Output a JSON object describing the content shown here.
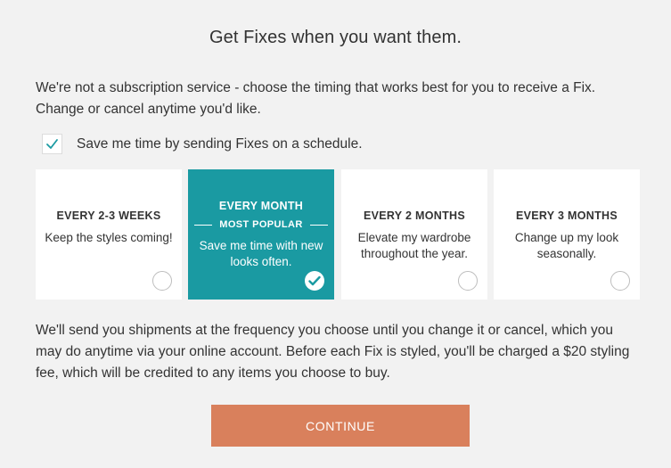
{
  "title": "Get Fixes when you want them.",
  "intro": "We're not a subscription service - choose the timing that works best for you to receive a Fix. Change or cancel anytime you'd like.",
  "schedule": {
    "checked": true,
    "label": "Save me time by sending Fixes on a schedule."
  },
  "options": [
    {
      "heading": "EVERY 2-3 WEEKS",
      "description": "Keep the styles coming!",
      "selected": false
    },
    {
      "heading": "EVERY MONTH",
      "badge": "MOST POPULAR",
      "description": "Save me time with new looks often.",
      "selected": true
    },
    {
      "heading": "EVERY 2 MONTHS",
      "description": "Elevate my wardrobe throughout the year.",
      "selected": false
    },
    {
      "heading": "EVERY 3 MONTHS",
      "description": "Change up my look seasonally.",
      "selected": false
    }
  ],
  "note": "We'll send you shipments at the frequency you choose until you change it or cancel, which you may do anytime via your online account. Before each Fix is styled, you'll be charged a $20 styling fee, which will be credited to any items you choose to buy.",
  "continue_label": "CONTINUE",
  "colors": {
    "background": "#f2f2f2",
    "selected_card": "#1a9aa2",
    "continue_button": "#d9805c",
    "check_accent": "#1a9aa2"
  }
}
